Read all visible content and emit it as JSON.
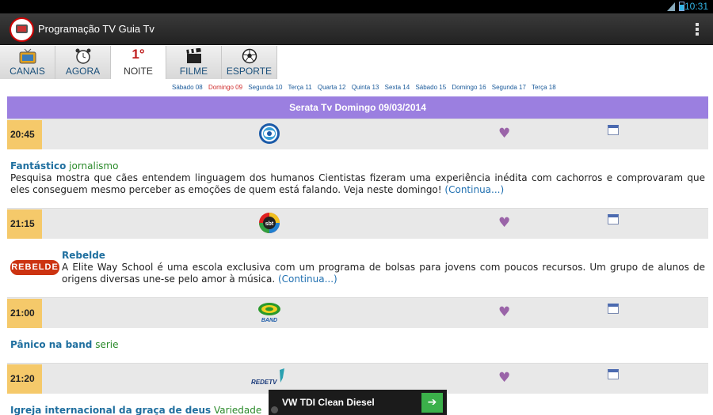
{
  "status_bar": {
    "network": "3G",
    "time": "10:31"
  },
  "app": {
    "title": "Programação TV Guia Tv"
  },
  "tabs": [
    {
      "label": "CANAIS",
      "icon": "tv-icon"
    },
    {
      "label": "AGORA",
      "icon": "alarm-clock-icon"
    },
    {
      "label": "NOITE",
      "icon": "first-place-icon",
      "glyph": "1°",
      "active": true
    },
    {
      "label": "FILME",
      "icon": "clapperboard-icon"
    },
    {
      "label": "ESPORTE",
      "icon": "soccer-ball-icon"
    }
  ],
  "days": [
    "Sábado 08",
    "Domingo 09",
    "Segunda 10",
    "Terça 11",
    "Quarta 12",
    "Quinta 13",
    "Sexta 14",
    "Sábado 15",
    "Domingo 16",
    "Segunda 17",
    "Terça 18"
  ],
  "selected_day_index": 1,
  "list_header": "Serata Tv Domingo 09/03/2014",
  "programs": [
    {
      "time": "20:45",
      "channel_icon": "globo-logo-icon",
      "name": "Fantástico",
      "genre": "jornalismo",
      "description": "Pesquisa mostra que cães entendem linguagem dos humanos Cientistas fizeram uma experiência inédita com cachorros e comprovaram que eles conseguem mesmo perceber as emoções de quem está falando. Veja neste domingo!",
      "more": "(Continua...)"
    },
    {
      "time": "21:15",
      "channel_icon": "sbt-logo-icon",
      "name": "Rebelde",
      "image_text": "REBELDE",
      "description": "A Elite Way School é uma escola exclusiva com um programa de bolsas para jovens com poucos recursos. Um grupo de alunos de origens diversas une-se pelo amor à música.",
      "more": "(Continua...)"
    },
    {
      "time": "21:00",
      "channel_icon": "band-logo-icon",
      "channel_label": "BAND",
      "name": "Pânico na band",
      "genre": "serie"
    },
    {
      "time": "21:20",
      "channel_icon": "redetv-logo-icon",
      "channel_label": "REDETV",
      "name": "Igreja internacional da graça de deus",
      "genre": "Variedade"
    }
  ],
  "ad": {
    "text": "VW TDI Clean Diesel",
    "button": "➔"
  },
  "colors": {
    "header": "#9b7fe0",
    "time_cell": "#f5c96a",
    "program_name": "#1f6f9f",
    "genre": "#2a8a2a",
    "selected_day": "#d03030"
  }
}
